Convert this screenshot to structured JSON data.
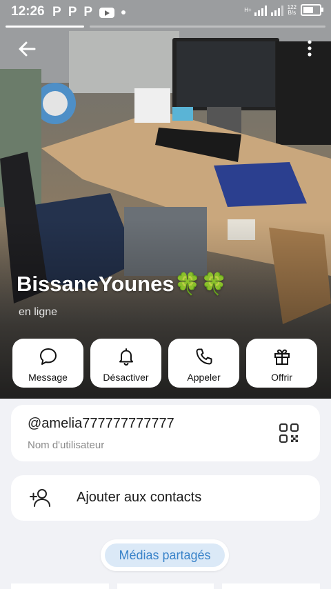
{
  "status_bar": {
    "time": "12:26",
    "notification_icons": [
      "P",
      "P",
      "P"
    ],
    "network_speed": "122",
    "network_unit": "B/s",
    "network_type": "H+"
  },
  "profile": {
    "name": "BissaneYounes🍀🍀",
    "status": "en ligne"
  },
  "actions": [
    {
      "label": "Message",
      "icon": "message-bubble-icon"
    },
    {
      "label": "Désactiver",
      "icon": "bell-icon"
    },
    {
      "label": "Appeler",
      "icon": "phone-icon"
    },
    {
      "label": "Offrir",
      "icon": "gift-icon"
    }
  ],
  "username": {
    "value": "@amelia777777777777",
    "label": "Nom d'utilisateur"
  },
  "add_contact": {
    "label": "Ajouter aux contacts"
  },
  "shared_media": {
    "label": "Médias partagés"
  },
  "colors": {
    "accent": "#3a83c9",
    "accent_bg": "#dbe9f7",
    "page_bg": "#f1f2f6"
  },
  "icons": {
    "back": "arrow-left-icon",
    "more": "more-vertical-icon",
    "qr": "qr-code-icon",
    "add_user": "add-user-icon"
  }
}
